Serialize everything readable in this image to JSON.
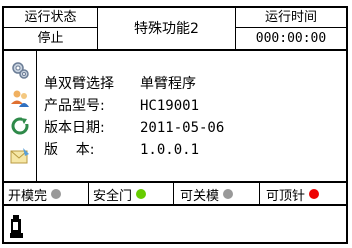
{
  "header": {
    "run_state_label": "运行状态",
    "run_state_value": "停止",
    "function_title": "特殊功能2",
    "run_time_label": "运行时间",
    "run_time_value": "000:00:00"
  },
  "info": {
    "rows": [
      {
        "label": "单双臂选择",
        "value": "单臂程序"
      },
      {
        "label": "产品型号:",
        "value": "HC19001"
      },
      {
        "label": "版本日期:",
        "value": "2011-05-06"
      },
      {
        "label": "版    本:",
        "value": "1.0.0.1"
      }
    ]
  },
  "side_icons": [
    "gears-icon",
    "users-icon",
    "refresh-icon",
    "envelope-icon"
  ],
  "status_bar": {
    "items": [
      {
        "label": "开模完",
        "state": "off",
        "color": "#999999"
      },
      {
        "label": "安全门",
        "state": "on",
        "color": "#66cc00"
      },
      {
        "label": "可关模",
        "state": "off",
        "color": "#999999"
      },
      {
        "label": "可顶针",
        "state": "alarm",
        "color": "#ee0000"
      }
    ]
  },
  "footer": {
    "icon": "robot-icon"
  }
}
